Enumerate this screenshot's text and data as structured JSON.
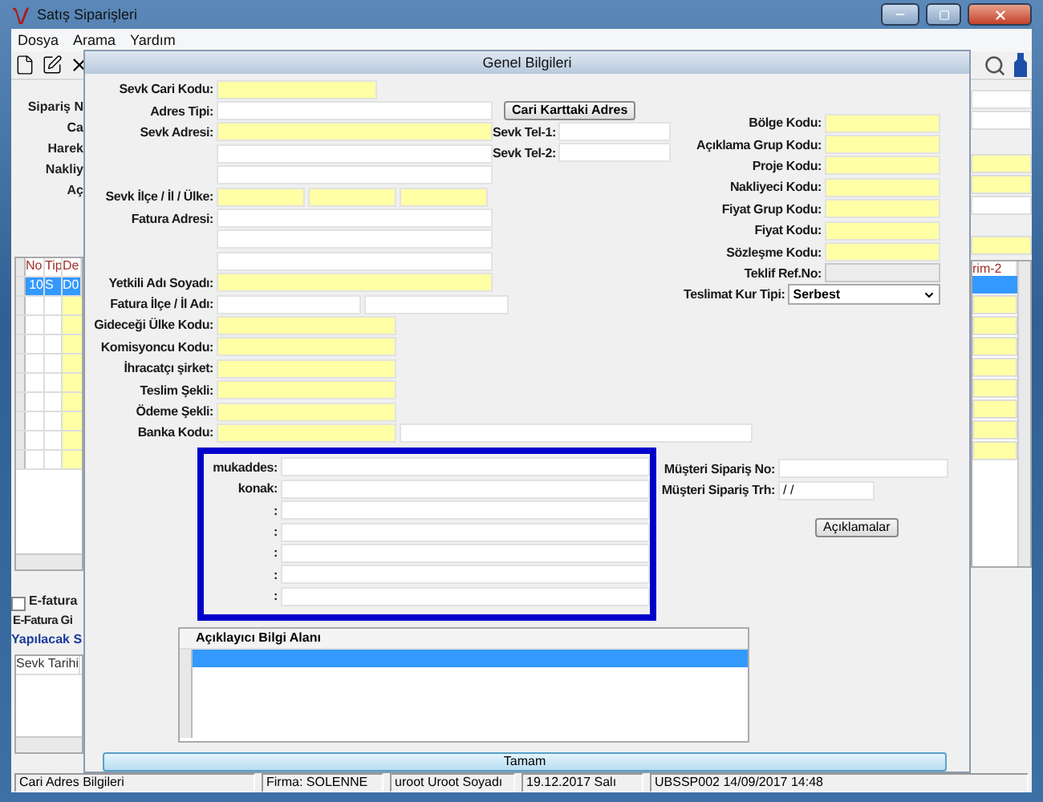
{
  "window": {
    "title": "Satış Siparişleri"
  },
  "menu": [
    {
      "label": "Dosya"
    },
    {
      "label": "Arama"
    },
    {
      "label": "Yardım"
    }
  ],
  "main_form": {
    "labels": [
      "Sipariş N",
      "Ca",
      "Harek",
      "Nakliy",
      "Aç"
    ],
    "lines_grid": {
      "columns": [
        "No",
        "Tip",
        "De"
      ],
      "rows": [
        {
          "cells": [
            "10",
            "S",
            "D0"
          ],
          "selected": true
        }
      ],
      "right_column": "rim-2"
    },
    "efatura": {
      "label": "E-fatura",
      "checked": false
    },
    "efatura_label": "E-Fatura Gi",
    "section_title": "Yapılacak S",
    "shipment_grid": {
      "columns": [
        "Sevk Tarihi"
      ]
    }
  },
  "dialog": {
    "title": "Genel Bilgileri",
    "left_rows": [
      {
        "label": "Sevk Cari Kodu:",
        "fields": [
          {
            "required": true
          }
        ]
      },
      {
        "label": "Adres Tipi:",
        "fields": [
          {
            "required": false
          }
        ]
      },
      {
        "label": "Sevk Adresi:",
        "fields": [
          {
            "required": true
          }
        ]
      },
      {
        "fields": [
          {
            "required": false
          }
        ]
      },
      {
        "fields": [
          {
            "required": false
          }
        ]
      },
      {
        "label": "Sevk İlçe / İl / Ülke:",
        "fields": [
          {
            "required": true
          },
          {
            "required": true
          },
          {
            "required": true
          }
        ]
      },
      {
        "label": "Fatura Adresi:",
        "fields": [
          {
            "required": false
          }
        ]
      },
      {
        "fields": [
          {
            "required": false
          }
        ]
      },
      {
        "fields": [
          {
            "required": false
          }
        ]
      },
      {
        "label": "Yetkili Adı Soyadı:",
        "fields": [
          {
            "required": true
          }
        ]
      },
      {
        "label": "Fatura İlçe / İl Adı:",
        "fields": [
          {
            "required": false
          },
          {
            "required": false
          }
        ]
      },
      {
        "label": "Gideceği Ülke Kodu:",
        "fields": [
          {
            "required": true
          }
        ]
      },
      {
        "label": "Komisyoncu Kodu:",
        "fields": [
          {
            "required": true
          }
        ]
      },
      {
        "label": "İhracatçı şirket:",
        "fields": [
          {
            "required": true
          }
        ]
      },
      {
        "label": "Teslim Şekli:",
        "fields": [
          {
            "required": true
          }
        ]
      },
      {
        "label": "Ödeme Şekli:",
        "fields": [
          {
            "required": true
          }
        ]
      },
      {
        "label": "Banka Kodu:",
        "fields": [
          {
            "required": true
          },
          {
            "required": false
          }
        ]
      }
    ],
    "address_button": "Cari Karttaki Adres",
    "phones": [
      {
        "label": "Sevk Tel-1:"
      },
      {
        "label": "Sevk Tel-2:"
      }
    ],
    "codes": [
      {
        "label": "Bölge Kodu:",
        "kind": "field",
        "required": true,
        "disabled": false
      },
      {
        "label": "Açıklama Grup Kodu:",
        "kind": "field",
        "required": true,
        "disabled": false
      },
      {
        "label": "Proje Kodu:",
        "kind": "field",
        "required": true,
        "disabled": false
      },
      {
        "label": "Nakliyeci Kodu:",
        "kind": "field",
        "required": true,
        "disabled": false
      },
      {
        "label": "Fiyat Grup Kodu:",
        "kind": "field",
        "required": true,
        "disabled": false
      },
      {
        "label": "Fiyat Kodu:",
        "kind": "field",
        "required": true,
        "disabled": false
      },
      {
        "label": "Sözleşme Kodu:",
        "kind": "field",
        "required": true,
        "disabled": false
      },
      {
        "label": "Teklif Ref.No:",
        "kind": "field",
        "required": false,
        "disabled": true
      },
      {
        "label": "Teslimat Kur Tipi:",
        "kind": "select",
        "value": "Serbest"
      }
    ],
    "custom_fields": {
      "highlighted": true,
      "rows": [
        {
          "label": "mukaddes:"
        },
        {
          "label": "konak:"
        },
        {
          "label": ":"
        },
        {
          "label": ":"
        },
        {
          "label": ":"
        },
        {
          "label": ":"
        },
        {
          "label": ":"
        }
      ]
    },
    "customer_order": {
      "number_label": "Müşteri Sipariş No:",
      "date_label": "Müşteri Sipariş Trh:",
      "date_value": " / /"
    },
    "notes_button": "Açıklamalar",
    "info_grid": {
      "header": "Açıklayıcı Bilgi Alanı",
      "rows": [
        {
          "selected": true
        },
        {
          "selected": false
        },
        {
          "selected": false
        },
        {
          "selected": false
        },
        {
          "selected": false
        }
      ]
    },
    "ok_button": "Tamam"
  },
  "status_bar": [
    "Cari Adres Bilgileri",
    "Firma: SOLENNE",
    "uroot Uroot Soyadı",
    "19.12.2017  Salı",
    "UBSSP002 14/09/2017 14:48"
  ]
}
